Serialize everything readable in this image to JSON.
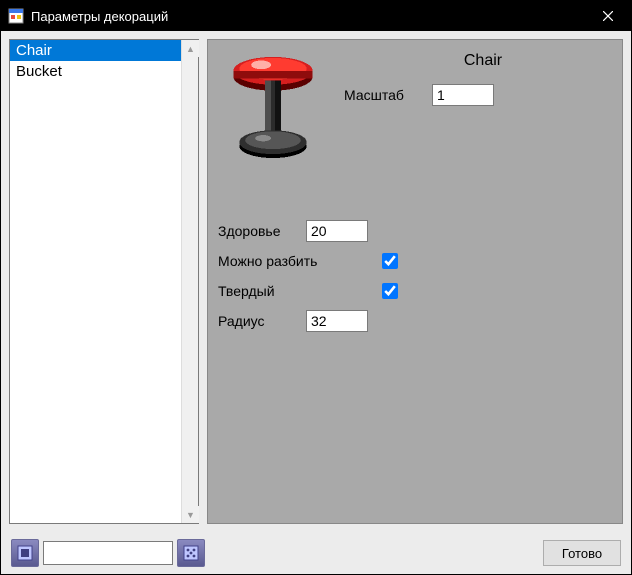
{
  "window": {
    "title": "Параметры декораций"
  },
  "list": {
    "items": [
      {
        "label": "Chair",
        "selected": true
      },
      {
        "label": "Bucket",
        "selected": false
      }
    ]
  },
  "properties": {
    "title": "Chair",
    "scale_label": "Масштаб",
    "scale_value": "1",
    "health_label": "Здоровье",
    "health_value": "20",
    "breakable_label": "Можно разбить",
    "breakable_value": true,
    "solid_label": "Твердый",
    "solid_value": true,
    "radius_label": "Радиус",
    "radius_value": "32"
  },
  "footer": {
    "search_value": "",
    "done_label": "Готово"
  },
  "icons": {
    "app": "form-icon",
    "close": "close-icon",
    "add": "add-icon",
    "dice": "dice-icon"
  }
}
